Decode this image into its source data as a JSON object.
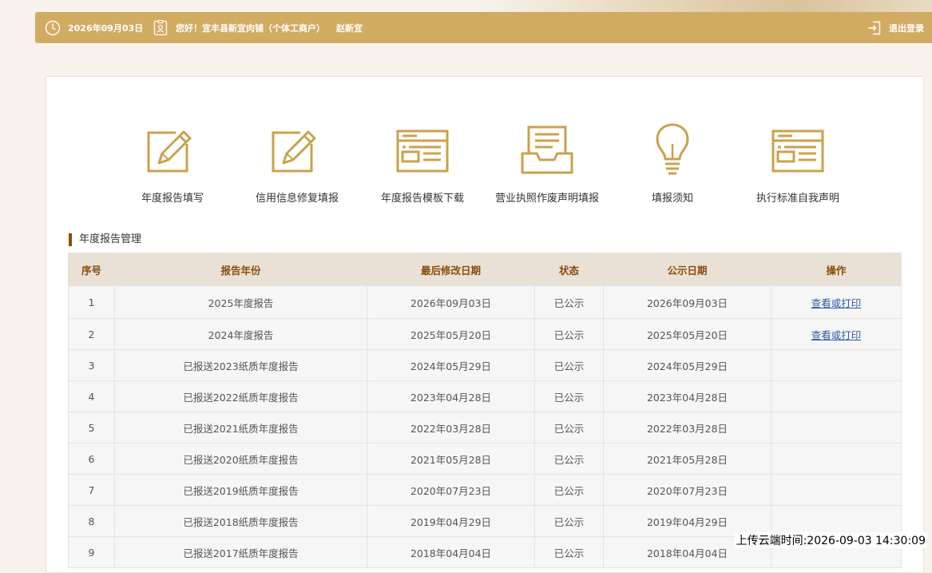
{
  "header": {
    "date": "2026年09月03日",
    "greeting": "您好！宜丰县新宜肉铺（个体工商户）",
    "user": "赵新宜",
    "logout_label": "退出登录"
  },
  "functions": [
    {
      "label": "年度报告填写",
      "icon": "pencil-edit-icon"
    },
    {
      "label": "信用信息修复填报",
      "icon": "pencil-edit-icon"
    },
    {
      "label": "年度报告模板下载",
      "icon": "template-document-icon"
    },
    {
      "label": "营业执照作废声明填报",
      "icon": "document-tray-icon"
    },
    {
      "label": "填报须知",
      "icon": "lightbulb-icon"
    },
    {
      "label": "执行标准自我声明",
      "icon": "template-document-icon"
    }
  ],
  "section_title": "年度报告管理",
  "table": {
    "headers": [
      "序号",
      "报告年份",
      "最后修改日期",
      "状态",
      "公示日期",
      "操作"
    ],
    "rows": [
      [
        "1",
        "2025年度报告",
        "2026年09月03日",
        "已公示",
        "2026年09月03日",
        "查看或打印"
      ],
      [
        "2",
        "2024年度报告",
        "2025年05月20日",
        "已公示",
        "2025年05月20日",
        "查看或打印"
      ],
      [
        "3",
        "已报送2023纸质年度报告",
        "2024年05月29日",
        "已公示",
        "2024年05月29日",
        ""
      ],
      [
        "4",
        "已报送2022纸质年度报告",
        "2023年04月28日",
        "已公示",
        "2023年04月28日",
        ""
      ],
      [
        "5",
        "已报送2021纸质年度报告",
        "2022年03月28日",
        "已公示",
        "2022年03月28日",
        ""
      ],
      [
        "6",
        "已报送2020纸质年度报告",
        "2021年05月28日",
        "已公示",
        "2021年05月28日",
        ""
      ],
      [
        "7",
        "已报送2019纸质年度报告",
        "2020年07月23日",
        "已公示",
        "2020年07月23日",
        ""
      ],
      [
        "8",
        "已报送2018纸质年度报告",
        "2019年04月29日",
        "已公示",
        "2019年04月29日",
        ""
      ],
      [
        "9",
        "已报送2017纸质年度报告",
        "2018年04月04日",
        "已公示",
        "2018年04月04日",
        ""
      ]
    ]
  },
  "upload_time": "上传云端时间:2026-09-03 14:30:09",
  "colors": {
    "accent": "#d2ab62",
    "icon": "#c9a24e",
    "header_text": "#8a4b0c",
    "link": "#2f5aa8"
  }
}
